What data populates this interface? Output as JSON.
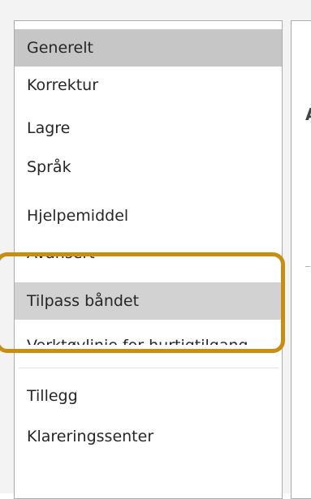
{
  "nav": {
    "items": [
      {
        "label": "Generelt"
      },
      {
        "label": "Korrektur"
      },
      {
        "label": "Lagre"
      },
      {
        "label": "Språk"
      },
      {
        "label": "Hjelpemiddel"
      },
      {
        "label": "Avansert"
      },
      {
        "label": "Tilpass båndet"
      },
      {
        "label": "Verktøylinje for hurtigtilgang"
      },
      {
        "label": "Tillegg"
      },
      {
        "label": "Klareringssenter"
      }
    ]
  },
  "content": {
    "heading_fragment": "A"
  },
  "highlight": {
    "color": "#c98d10"
  }
}
